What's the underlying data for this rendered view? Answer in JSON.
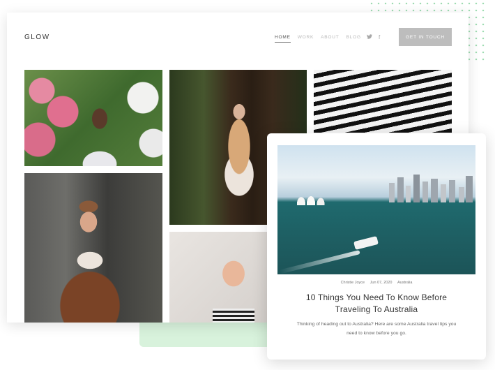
{
  "brand": {
    "name": "GLOW"
  },
  "nav": {
    "items": [
      {
        "label": "HOME",
        "active": true
      },
      {
        "label": "WORK",
        "active": false
      },
      {
        "label": "ABOUT",
        "active": false
      },
      {
        "label": "BLOG",
        "active": false
      }
    ],
    "social_icons": [
      "twitter-icon",
      "facebook-icon"
    ],
    "social_glyphs": {
      "twitter": "🐦",
      "facebook": "f"
    },
    "cta_label": "GET IN TOUCH"
  },
  "gallery": {
    "photos": [
      "woman-with-flowers-photo",
      "woman-in-forest-photo",
      "striped-architecture-photo",
      "man-in-jacket-photo",
      "blonde-woman-photo"
    ]
  },
  "blog_card": {
    "image": "sydney-harbour-photo",
    "author": "Christie Joyce",
    "date": "Jun 07, 2020",
    "category": "Australia",
    "title": "10 Things You Need To Know Before Traveling To Australia",
    "excerpt": "Thinking of heading out to Australia? Here are some Australia travel tips you need to know before you go."
  },
  "colors": {
    "accent_green": "#d8f2dc",
    "dot_green": "#8fd6a6",
    "cta_bg": "#bdbdbd"
  }
}
